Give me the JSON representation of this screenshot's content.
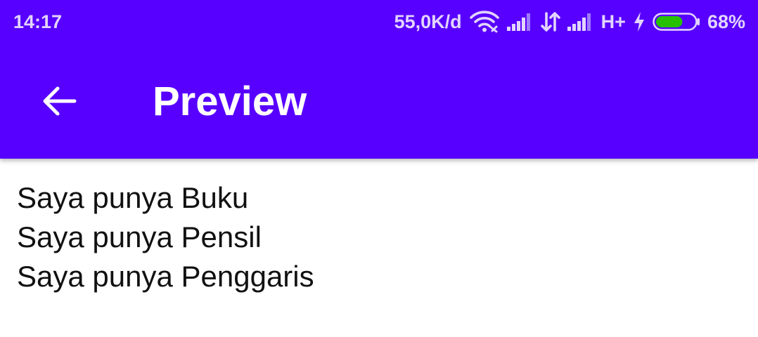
{
  "status_bar": {
    "time": "14:17",
    "network_speed": "55,0K/d",
    "wifi_icon": "wifi-icon",
    "signal_icon": "signal-bars-icon",
    "data_activity_icon": "data-transfer-arrows-icon",
    "network_type": "H+",
    "charging_icon": "lightning-bolt-icon",
    "battery_percent": "68%",
    "battery_level": 0.68,
    "battery_color": "#27c100"
  },
  "toolbar": {
    "back_icon": "arrow-left-icon",
    "title": "Preview",
    "background_color": "#5800ff"
  },
  "content": {
    "lines": [
      "Saya punya Buku",
      "Saya punya Pensil",
      "Saya punya Penggaris"
    ]
  }
}
